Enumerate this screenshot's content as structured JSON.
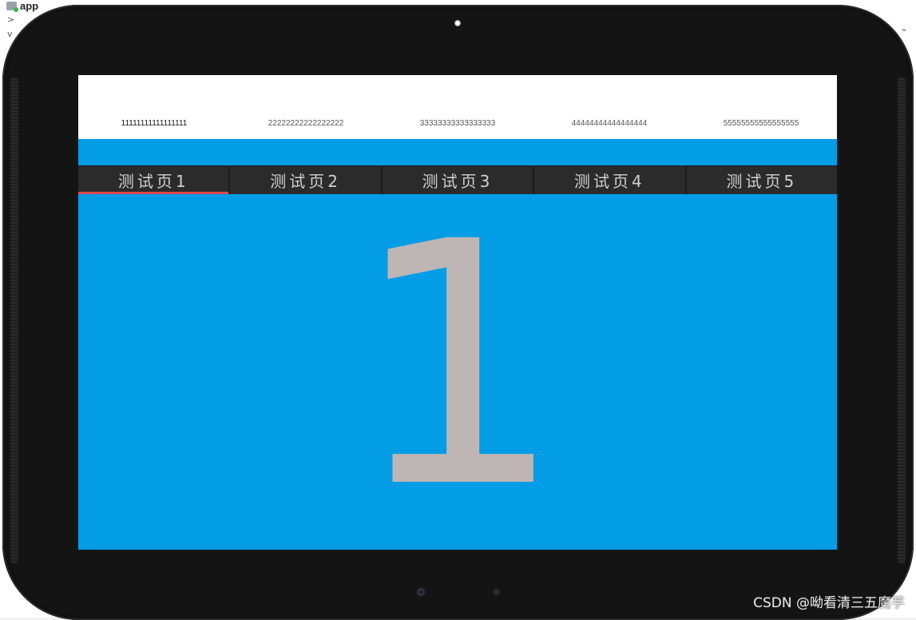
{
  "ide": {
    "app_label": "app",
    "chevrons": [
      ">",
      "v"
    ],
    "right_edge_glyph": "⌄"
  },
  "screen": {
    "label_bar": [
      "11111111111111111",
      "22222222222222222",
      "33333333333333333",
      "44444444444444444",
      "55555555555555555"
    ],
    "tabs": [
      {
        "label": "测试页1",
        "active": true
      },
      {
        "label": "测试页2",
        "active": false
      },
      {
        "label": "测试页3",
        "active": false
      },
      {
        "label": "测试页4",
        "active": false
      },
      {
        "label": "测试页5",
        "active": false
      }
    ],
    "page_number": "1"
  },
  "watermark": "CSDN @呦看清三五魔芋",
  "colors": {
    "screen_background": "#039de6",
    "tab_strip": "#2b2b2b",
    "tab_indicator": "#e0484e",
    "big_number": "#bdb6b4"
  }
}
